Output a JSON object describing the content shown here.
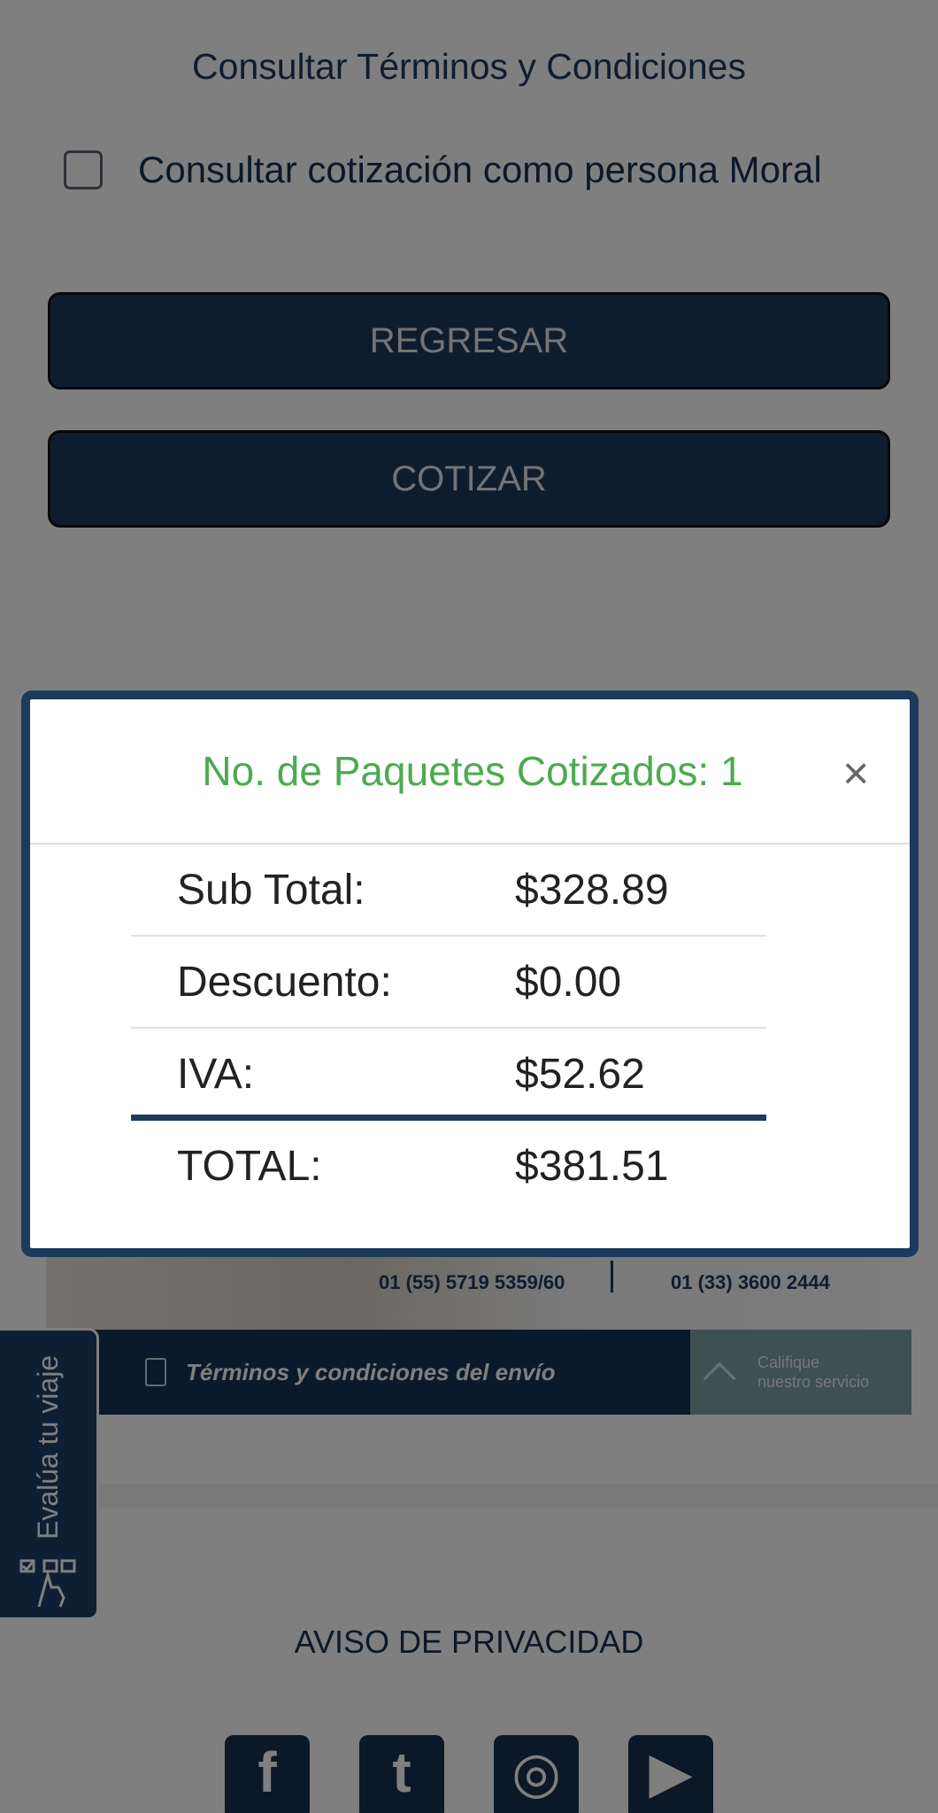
{
  "form": {
    "terms_link": "Consultar Términos y Condiciones",
    "moral_checkbox_label": "Consultar cotización como persona Moral",
    "moral_checked": false,
    "back_button": "REGRESAR",
    "quote_button": "COTIZAR"
  },
  "banner": {
    "phone_1": "01 (55) 5719 5359/60",
    "phone_2": "01 (33) 3600 2444",
    "shipping_terms": "Términos y condiciones del envío",
    "rate_line_1": "Califique",
    "rate_line_2": "nuestro servicio"
  },
  "side_tab": {
    "label": "Evalúa tu viaje",
    "icon": "survey-hand-icon"
  },
  "footer": {
    "privacy": "AVISO DE PRIVACIDAD",
    "social": [
      {
        "name": "facebook-icon",
        "glyph": "f"
      },
      {
        "name": "twitter-icon",
        "glyph": "t"
      },
      {
        "name": "instagram-icon",
        "glyph": "◎"
      },
      {
        "name": "youtube-icon",
        "glyph": "▶"
      }
    ]
  },
  "modal": {
    "title": "No. de Paquetes Cotizados: 1",
    "close_glyph": "×",
    "rows": [
      {
        "label": "Sub Total:",
        "value": "$328.89"
      },
      {
        "label": "Descuento:",
        "value": "$0.00"
      },
      {
        "label": "IVA:",
        "value": "$52.62"
      },
      {
        "label": "TOTAL:",
        "value": "$381.51"
      }
    ]
  },
  "colors": {
    "primary": "#1d3a5c",
    "title_green": "#4caa50",
    "overlay": "rgba(0,0,0,0.5)"
  }
}
